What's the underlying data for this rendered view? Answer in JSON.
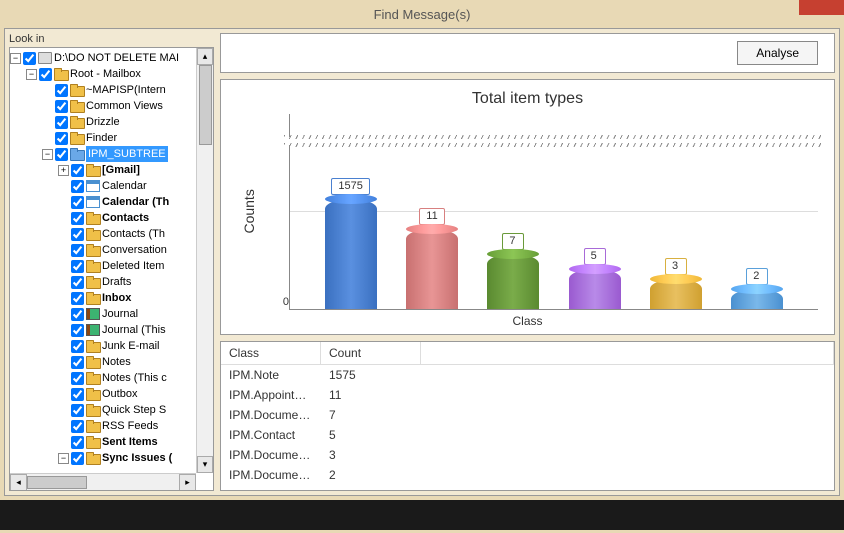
{
  "window": {
    "title": "Find Message(s)"
  },
  "lookin_label": "Look in",
  "analyse_label": "Analyse",
  "tree": {
    "root": "D:\\DO NOT DELETE MAI",
    "mailbox": "Root - Mailbox",
    "items": [
      "~MAPISP(Intern",
      "Common Views",
      "Drizzle",
      "Finder"
    ],
    "ipm": "IPM_SUBTREE",
    "ipm_children": [
      {
        "label": "[Gmail]",
        "bold": true,
        "exp": "+",
        "icon": "folder"
      },
      {
        "label": "Calendar",
        "icon": "cal"
      },
      {
        "label": "Calendar (Th",
        "bold": true,
        "icon": "cal"
      },
      {
        "label": "Contacts",
        "bold": true,
        "icon": "folder"
      },
      {
        "label": "Contacts (Th",
        "icon": "folder"
      },
      {
        "label": "Conversation",
        "icon": "folder"
      },
      {
        "label": "Deleted Item",
        "icon": "folder"
      },
      {
        "label": "Drafts",
        "icon": "folder"
      },
      {
        "label": "Inbox",
        "bold": true,
        "icon": "folder"
      },
      {
        "label": "Journal",
        "icon": "journal"
      },
      {
        "label": "Journal (This",
        "icon": "journal"
      },
      {
        "label": "Junk E-mail",
        "icon": "folder"
      },
      {
        "label": "Notes",
        "icon": "folder"
      },
      {
        "label": "Notes (This c",
        "icon": "folder"
      },
      {
        "label": "Outbox",
        "icon": "folder"
      },
      {
        "label": "Quick Step S",
        "icon": "folder"
      },
      {
        "label": "RSS Feeds",
        "icon": "folder"
      },
      {
        "label": "Sent Items",
        "bold": true,
        "icon": "folder"
      },
      {
        "label": "Sync Issues (",
        "bold": true,
        "exp": "-",
        "icon": "folder"
      }
    ]
  },
  "chart_data": {
    "type": "bar",
    "title": "Total item types",
    "xlabel": "Class",
    "ylabel": "Counts",
    "ylim": [
      0,
      1575
    ],
    "axis_break": true,
    "categories": [
      "IPM.Note",
      "IPM.Appointment",
      "IPM.Document.T...",
      "IPM.Contact",
      "IPM.Document.O...",
      "IPM.Document.O..."
    ],
    "values": [
      1575,
      11,
      7,
      5,
      3,
      2
    ],
    "colors": [
      "#4a80d0",
      "#d88080",
      "#6a9a3a",
      "#a86ad8",
      "#d8b040",
      "#5aa0da"
    ]
  },
  "table": {
    "headers": [
      "Class",
      "Count"
    ],
    "rows": [
      [
        "IPM.Note",
        "1575"
      ],
      [
        "IPM.Appointment",
        "11"
      ],
      [
        "IPM.Document.T...",
        "7"
      ],
      [
        "IPM.Contact",
        "5"
      ],
      [
        "IPM.Document.O...",
        "3"
      ],
      [
        "IPM.Document.O...",
        "2"
      ]
    ]
  },
  "ytick0": "0"
}
